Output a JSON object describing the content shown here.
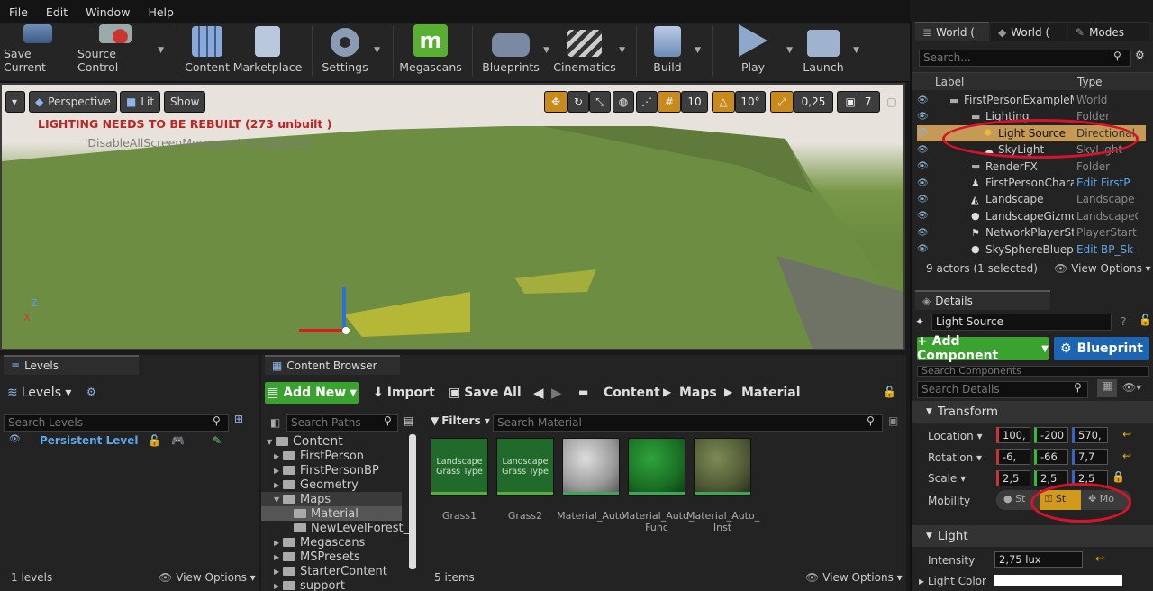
{
  "menu": [
    "File",
    "Edit",
    "Window",
    "Help"
  ],
  "toolbar": {
    "save_current": "Save Current",
    "source_control": "Source Control",
    "content": "Content",
    "marketplace": "Marketplace",
    "settings": "Settings",
    "megascans": "Megascans",
    "blueprints": "Blueprints",
    "cinematics": "Cinematics",
    "build": "Build",
    "play": "Play",
    "launch": "Launch"
  },
  "viewport": {
    "perspective": "Perspective",
    "lit": "Lit",
    "show": "Show",
    "warning": "LIGHTING NEEDS TO BE REBUILT (273 unbuilt )",
    "suppress": "'DisableAllScreenMessages' to suppress",
    "grid_snap": "10",
    "rot_snap": "10°",
    "scale_snap": "0,25",
    "cam_speed": "7"
  },
  "world_outliner": {
    "tabs": [
      "World (",
      "World (",
      "Modes"
    ],
    "search_placeholder": "Search...",
    "col_label": "Label",
    "col_type": "Type",
    "rows": [
      {
        "label": "FirstPersonExampleM",
        "type": "World"
      },
      {
        "label": "Lighting",
        "type": "Folder"
      },
      {
        "label": "Light Source",
        "type": "Directional"
      },
      {
        "label": "SkyLight",
        "type": "SkyLight"
      },
      {
        "label": "RenderFX",
        "type": "Folder"
      },
      {
        "label": "FirstPersonCharacte",
        "type": "Edit FirstP"
      },
      {
        "label": "Landscape",
        "type": "Landscape"
      },
      {
        "label": "LandscapeGizmoAc",
        "type": "LandscapeG"
      },
      {
        "label": "NetworkPlayerStart",
        "type": "PlayerStart"
      },
      {
        "label": "SkySphereBlueprint",
        "type": "Edit BP_Sk"
      }
    ],
    "footer": "9 actors (1 selected)",
    "view_options": "View Options"
  },
  "details": {
    "tab": "Details",
    "selected": "Light Source",
    "add_component": "+ Add Component",
    "blueprint": "Blueprint",
    "search_components": "Search Components",
    "search_details": "Search Details",
    "transform": "Transform",
    "location_label": "Location",
    "location": [
      "100,",
      "-200",
      "570,"
    ],
    "rotation_label": "Rotation",
    "rotation": [
      "-6,",
      "-66",
      "7,7"
    ],
    "scale_label": "Scale",
    "scale": [
      "2,5",
      "2,5",
      "2,5"
    ],
    "mobility_label": "Mobility",
    "mobility": [
      "St",
      "St",
      "Mo"
    ],
    "light": "Light",
    "intensity_label": "Intensity",
    "intensity": "2,75 lux",
    "light_color_label": "Light Color"
  },
  "levels": {
    "tab": "Levels",
    "title": "Levels",
    "search": "Search Levels",
    "persistent": "Persistent Level",
    "footer": "1 levels",
    "view_options": "View Options"
  },
  "content_browser": {
    "tab": "Content Browser",
    "add_new": "Add New",
    "import": "Import",
    "save_all": "Save All",
    "path": [
      "Content",
      "Maps",
      "Material"
    ],
    "search_paths": "Search Paths",
    "filters": "Filters",
    "search_material": "Search Material",
    "tree": [
      "Content",
      "FirstPerson",
      "FirstPersonBP",
      "Geometry",
      "Maps",
      "Material",
      "NewLevelForest_s",
      "Megascans",
      "MSPresets",
      "StarterContent",
      "support"
    ],
    "assets": [
      {
        "name": "Grass1",
        "thumb": "Landscape Grass Type"
      },
      {
        "name": "Grass2",
        "thumb": "Landscape Grass Type"
      },
      {
        "name": "Material_Auto",
        "thumb": ""
      },
      {
        "name": "Material_Auto_ Func",
        "thumb": ""
      },
      {
        "name": "Material_Auto_ Inst",
        "thumb": ""
      }
    ],
    "items": "5 items",
    "view_options": "View Options"
  }
}
